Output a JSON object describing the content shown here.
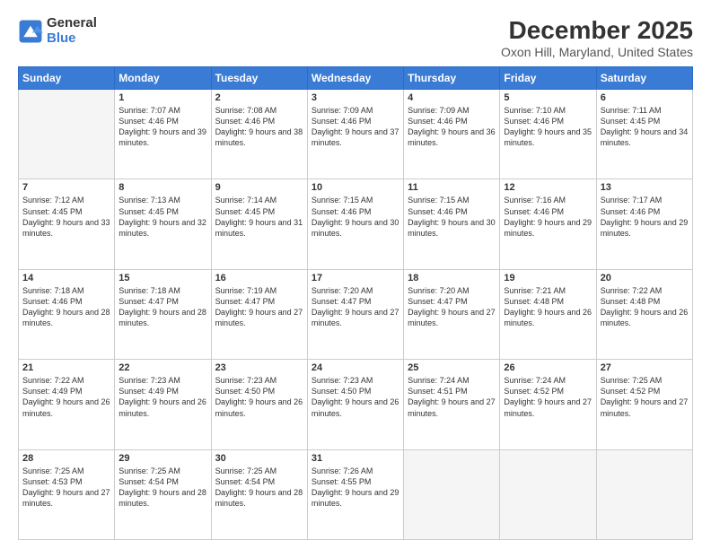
{
  "logo": {
    "general": "General",
    "blue": "Blue"
  },
  "title": "December 2025",
  "subtitle": "Oxon Hill, Maryland, United States",
  "headers": [
    "Sunday",
    "Monday",
    "Tuesday",
    "Wednesday",
    "Thursday",
    "Friday",
    "Saturday"
  ],
  "weeks": [
    [
      {
        "day": "",
        "empty": true
      },
      {
        "day": "1",
        "sunrise": "7:07 AM",
        "sunset": "4:46 PM",
        "daylight": "9 hours and 39 minutes."
      },
      {
        "day": "2",
        "sunrise": "7:08 AM",
        "sunset": "4:46 PM",
        "daylight": "9 hours and 38 minutes."
      },
      {
        "day": "3",
        "sunrise": "7:09 AM",
        "sunset": "4:46 PM",
        "daylight": "9 hours and 37 minutes."
      },
      {
        "day": "4",
        "sunrise": "7:09 AM",
        "sunset": "4:46 PM",
        "daylight": "9 hours and 36 minutes."
      },
      {
        "day": "5",
        "sunrise": "7:10 AM",
        "sunset": "4:46 PM",
        "daylight": "9 hours and 35 minutes."
      },
      {
        "day": "6",
        "sunrise": "7:11 AM",
        "sunset": "4:45 PM",
        "daylight": "9 hours and 34 minutes."
      }
    ],
    [
      {
        "day": "7",
        "sunrise": "7:12 AM",
        "sunset": "4:45 PM",
        "daylight": "9 hours and 33 minutes."
      },
      {
        "day": "8",
        "sunrise": "7:13 AM",
        "sunset": "4:45 PM",
        "daylight": "9 hours and 32 minutes."
      },
      {
        "day": "9",
        "sunrise": "7:14 AM",
        "sunset": "4:45 PM",
        "daylight": "9 hours and 31 minutes."
      },
      {
        "day": "10",
        "sunrise": "7:15 AM",
        "sunset": "4:46 PM",
        "daylight": "9 hours and 30 minutes."
      },
      {
        "day": "11",
        "sunrise": "7:15 AM",
        "sunset": "4:46 PM",
        "daylight": "9 hours and 30 minutes."
      },
      {
        "day": "12",
        "sunrise": "7:16 AM",
        "sunset": "4:46 PM",
        "daylight": "9 hours and 29 minutes."
      },
      {
        "day": "13",
        "sunrise": "7:17 AM",
        "sunset": "4:46 PM",
        "daylight": "9 hours and 29 minutes."
      }
    ],
    [
      {
        "day": "14",
        "sunrise": "7:18 AM",
        "sunset": "4:46 PM",
        "daylight": "9 hours and 28 minutes."
      },
      {
        "day": "15",
        "sunrise": "7:18 AM",
        "sunset": "4:47 PM",
        "daylight": "9 hours and 28 minutes."
      },
      {
        "day": "16",
        "sunrise": "7:19 AM",
        "sunset": "4:47 PM",
        "daylight": "9 hours and 27 minutes."
      },
      {
        "day": "17",
        "sunrise": "7:20 AM",
        "sunset": "4:47 PM",
        "daylight": "9 hours and 27 minutes."
      },
      {
        "day": "18",
        "sunrise": "7:20 AM",
        "sunset": "4:47 PM",
        "daylight": "9 hours and 27 minutes."
      },
      {
        "day": "19",
        "sunrise": "7:21 AM",
        "sunset": "4:48 PM",
        "daylight": "9 hours and 26 minutes."
      },
      {
        "day": "20",
        "sunrise": "7:22 AM",
        "sunset": "4:48 PM",
        "daylight": "9 hours and 26 minutes."
      }
    ],
    [
      {
        "day": "21",
        "sunrise": "7:22 AM",
        "sunset": "4:49 PM",
        "daylight": "9 hours and 26 minutes."
      },
      {
        "day": "22",
        "sunrise": "7:23 AM",
        "sunset": "4:49 PM",
        "daylight": "9 hours and 26 minutes."
      },
      {
        "day": "23",
        "sunrise": "7:23 AM",
        "sunset": "4:50 PM",
        "daylight": "9 hours and 26 minutes."
      },
      {
        "day": "24",
        "sunrise": "7:23 AM",
        "sunset": "4:50 PM",
        "daylight": "9 hours and 26 minutes."
      },
      {
        "day": "25",
        "sunrise": "7:24 AM",
        "sunset": "4:51 PM",
        "daylight": "9 hours and 27 minutes."
      },
      {
        "day": "26",
        "sunrise": "7:24 AM",
        "sunset": "4:52 PM",
        "daylight": "9 hours and 27 minutes."
      },
      {
        "day": "27",
        "sunrise": "7:25 AM",
        "sunset": "4:52 PM",
        "daylight": "9 hours and 27 minutes."
      }
    ],
    [
      {
        "day": "28",
        "sunrise": "7:25 AM",
        "sunset": "4:53 PM",
        "daylight": "9 hours and 27 minutes."
      },
      {
        "day": "29",
        "sunrise": "7:25 AM",
        "sunset": "4:54 PM",
        "daylight": "9 hours and 28 minutes."
      },
      {
        "day": "30",
        "sunrise": "7:25 AM",
        "sunset": "4:54 PM",
        "daylight": "9 hours and 28 minutes."
      },
      {
        "day": "31",
        "sunrise": "7:26 AM",
        "sunset": "4:55 PM",
        "daylight": "9 hours and 29 minutes."
      },
      {
        "day": "",
        "empty": true
      },
      {
        "day": "",
        "empty": true
      },
      {
        "day": "",
        "empty": true
      }
    ]
  ]
}
